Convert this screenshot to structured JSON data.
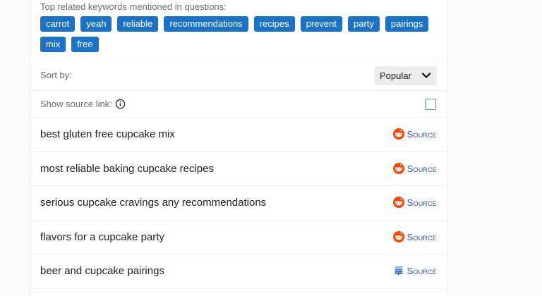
{
  "keywords_heading": "Top related keywords mentioned in questions:",
  "keywords": [
    "carrot",
    "yeah",
    "reliable",
    "recommendations",
    "recipes",
    "prevent",
    "party",
    "pairings",
    "mix",
    "free"
  ],
  "sort": {
    "label": "Sort by:",
    "selected": "Popular"
  },
  "source_toggle": {
    "label": "Show source link:",
    "checked": false
  },
  "questions": [
    {
      "text": "best gluten free cupcake mix",
      "source_label": "Source",
      "source_icon": "reddit-icon"
    },
    {
      "text": "most reliable baking cupcake recipes",
      "source_label": "Source",
      "source_icon": "reddit-icon"
    },
    {
      "text": "serious cupcake cravings any recommendations",
      "source_label": "Source",
      "source_icon": "reddit-icon"
    },
    {
      "text": "flavors for a cupcake party",
      "source_label": "Source",
      "source_icon": "reddit-icon"
    },
    {
      "text": "beer and cupcake pairings",
      "source_label": "Source",
      "source_icon": "stack-exchange-icon"
    }
  ],
  "colors": {
    "chip_bg": "#1a73c9",
    "link": "#3350b5",
    "reddit": "#ff4500",
    "stack": "#2f6fc4"
  }
}
